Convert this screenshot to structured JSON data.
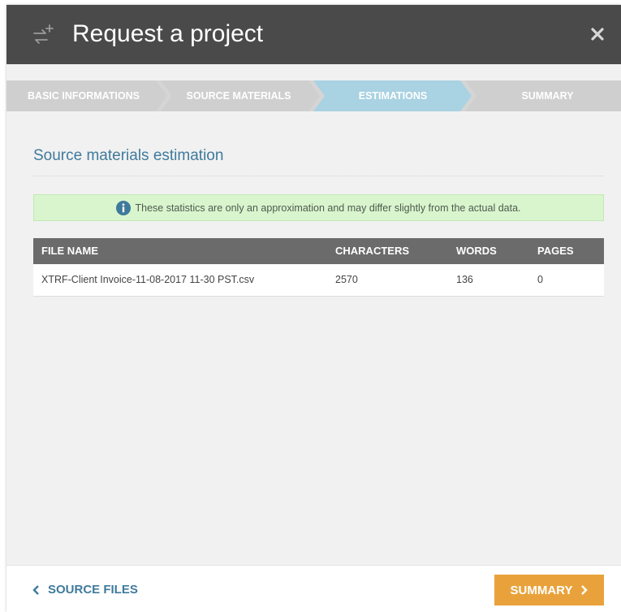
{
  "header": {
    "title": "Request a project",
    "icon": "add-workflow-icon",
    "close_icon": "close-icon",
    "background": "#4a4a4a"
  },
  "steps": [
    {
      "label": "BASIC INFORMATIONS",
      "state": "done"
    },
    {
      "label": "SOURCE MATERIALS",
      "state": "done"
    },
    {
      "label": "ESTIMATIONS",
      "state": "active"
    },
    {
      "label": "SUMMARY",
      "state": "pending"
    }
  ],
  "colors": {
    "step_inactive": "#cfcfcf",
    "step_active": "#a9d2e2",
    "accent": "#3f7a9c",
    "notice_bg": "#d9f5cd",
    "primary_button": "#e9a23b"
  },
  "main": {
    "section_title": "Source materials estimation",
    "notice": "These statistics are only an approximation and may differ slightly from the actual data.",
    "table": {
      "columns": [
        "FILE NAME",
        "CHARACTERS",
        "WORDS",
        "PAGES"
      ],
      "rows": [
        [
          "XTRF-Client Invoice-11-08-2017 11-30 PST.csv",
          "2570",
          "136",
          "0"
        ]
      ]
    }
  },
  "footer": {
    "back_label": "SOURCE FILES",
    "next_label": "SUMMARY"
  }
}
